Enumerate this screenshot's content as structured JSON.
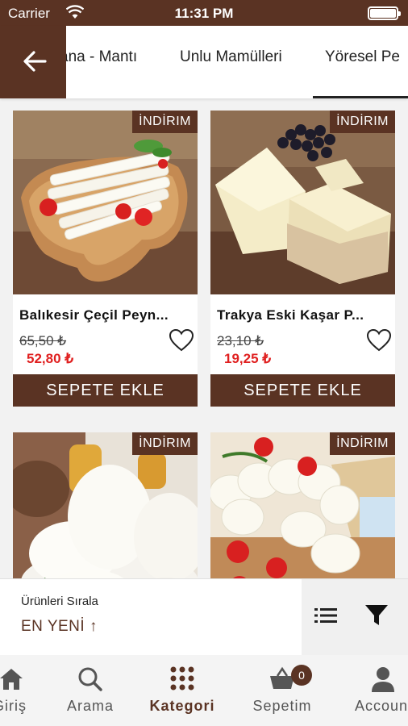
{
  "status_bar": {
    "carrier": "Carrier",
    "time": "11:31 PM"
  },
  "category_tabs": [
    {
      "label": "ana - Mantı"
    },
    {
      "label": "Unlu Mamülleri"
    },
    {
      "label": "Yöresel Pe",
      "selected": true
    }
  ],
  "products": [
    {
      "badge": "İNDİRIM",
      "name": "Balıkesir Çeçil Peyn...",
      "old_price": "65,50 ₺",
      "new_price": "52,80 ₺",
      "button": "SEPETE EKLE"
    },
    {
      "badge": "İNDİRIM",
      "name": "Trakya Eski Kaşar P...",
      "old_price": "23,10 ₺",
      "new_price": "19,25 ₺",
      "button": "SEPETE EKLE"
    },
    {
      "badge": "İNDİRIM"
    },
    {
      "badge": "İNDİRIM"
    }
  ],
  "sort": {
    "title": "Ürünleri Sırala",
    "value": "EN YENİ ↑"
  },
  "bottom_nav": [
    {
      "label": "Giriş",
      "icon": "home-icon"
    },
    {
      "label": "Arama",
      "icon": "search-icon"
    },
    {
      "label": "Kategori",
      "icon": "grid-dots-icon",
      "active": true
    },
    {
      "label": "Sepetim",
      "icon": "basket-icon",
      "badge": "0"
    },
    {
      "label": "Account",
      "icon": "user-icon"
    }
  ],
  "colors": {
    "brand": "#5a3323",
    "discount": "#e02020"
  }
}
